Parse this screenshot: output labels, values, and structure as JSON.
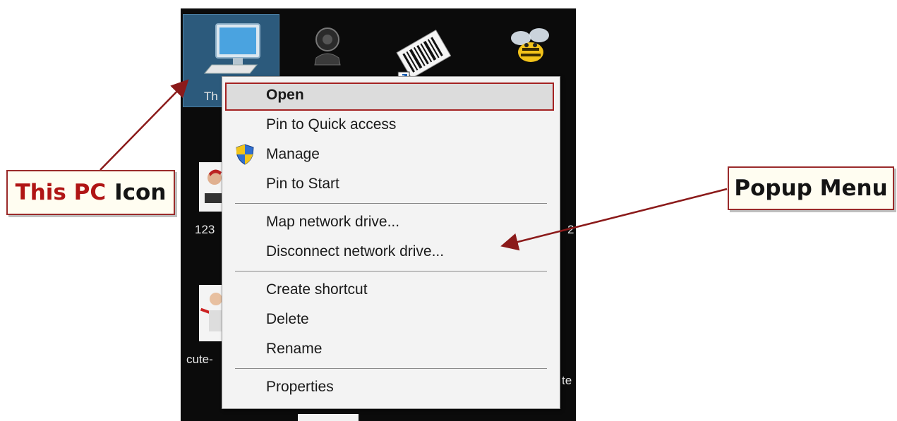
{
  "desktop": {
    "icons": [
      {
        "name": "this-pc-icon",
        "label": "Th"
      },
      {
        "name": "webcam-icon",
        "label": ""
      },
      {
        "name": "barcode-shortcut-icon",
        "label": ""
      },
      {
        "name": "bee-icon",
        "label": ""
      },
      {
        "name": "user-icon-1",
        "label": "123"
      },
      {
        "name": "user-icon-2",
        "label": "cute-"
      }
    ],
    "right_labels": [
      "2",
      "te"
    ]
  },
  "menu": {
    "items": [
      {
        "label": "Open",
        "bold": true
      },
      {
        "label": "Pin to Quick access"
      },
      {
        "label": "Manage",
        "icon": "uac-shield-icon"
      },
      {
        "label": "Pin to Start"
      },
      {
        "label": "Map network drive..."
      },
      {
        "label": "Disconnect network drive..."
      },
      {
        "label": "Create shortcut"
      },
      {
        "label": "Delete"
      },
      {
        "label": "Rename"
      },
      {
        "label": "Properties"
      }
    ]
  },
  "callouts": {
    "this_pc_red": "This PC",
    "this_pc_black": "Icon",
    "popup_menu": "Popup Menu"
  },
  "colors": {
    "callout_text_red": "#b01515",
    "callout_border": "#9a2a2a",
    "arrow": "#8b1a1a",
    "desktop_bg": "#0b0b0b",
    "menu_bg": "#f3f3f3"
  }
}
